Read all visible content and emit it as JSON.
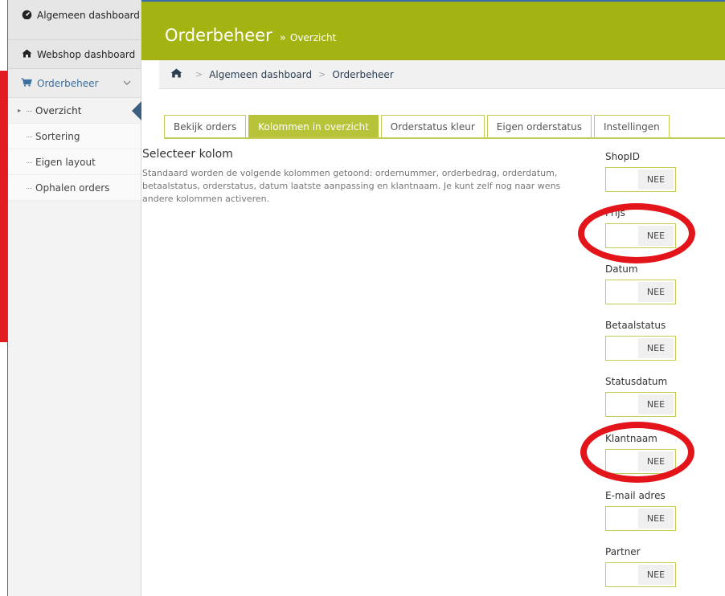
{
  "sidebar": {
    "top_items": [
      {
        "icon": "dashboard-gauge-icon",
        "label": "Algemeen dashboard"
      },
      {
        "icon": "home-icon",
        "label": "Webshop dashboard"
      }
    ],
    "section": {
      "icon": "cart-icon",
      "label": "Orderbeheer"
    },
    "sub_items": [
      {
        "label": "Overzicht",
        "active": true
      },
      {
        "label": "Sortering"
      },
      {
        "label": "Eigen layout"
      },
      {
        "label": "Ophalen orders"
      }
    ]
  },
  "header": {
    "title": "Orderbeheer",
    "separator": "»",
    "subtitle": "Overzicht",
    "color": "#a3b312"
  },
  "breadcrumb": {
    "home_icon": "home-icon",
    "items": [
      "Algemeen dashboard",
      "Orderbeheer"
    ]
  },
  "tabs": [
    {
      "label": "Bekijk orders"
    },
    {
      "label": "Kolommen in overzicht",
      "active": true
    },
    {
      "label": "Orderstatus kleur"
    },
    {
      "label": "Eigen orderstatus"
    },
    {
      "label": "Instellingen"
    }
  ],
  "content": {
    "title": "Selecteer kolom",
    "description": "Standaard worden de volgende kolommen getoond: ordernummer, orderbedrag, orderdatum, betaalstatus, orderstatus, datum laatste aanpassing en klantnaam. Je kunt zelf nog naar wens andere kolommen activeren."
  },
  "fields": [
    {
      "label": "ShopID",
      "value": "NEE"
    },
    {
      "label": "Prijs",
      "value": "NEE"
    },
    {
      "label": "Datum",
      "value": "NEE"
    },
    {
      "label": "Betaalstatus",
      "value": "NEE"
    },
    {
      "label": "Statusdatum",
      "value": "NEE"
    },
    {
      "label": "Klantnaam",
      "value": "NEE"
    },
    {
      "label": "E-mail adres",
      "value": "NEE"
    },
    {
      "label": "Partner",
      "value": "NEE"
    }
  ],
  "colors": {
    "accent": "#a3b312",
    "highlight_ring": "#e4141b",
    "active_tab": "#b7c43a"
  }
}
